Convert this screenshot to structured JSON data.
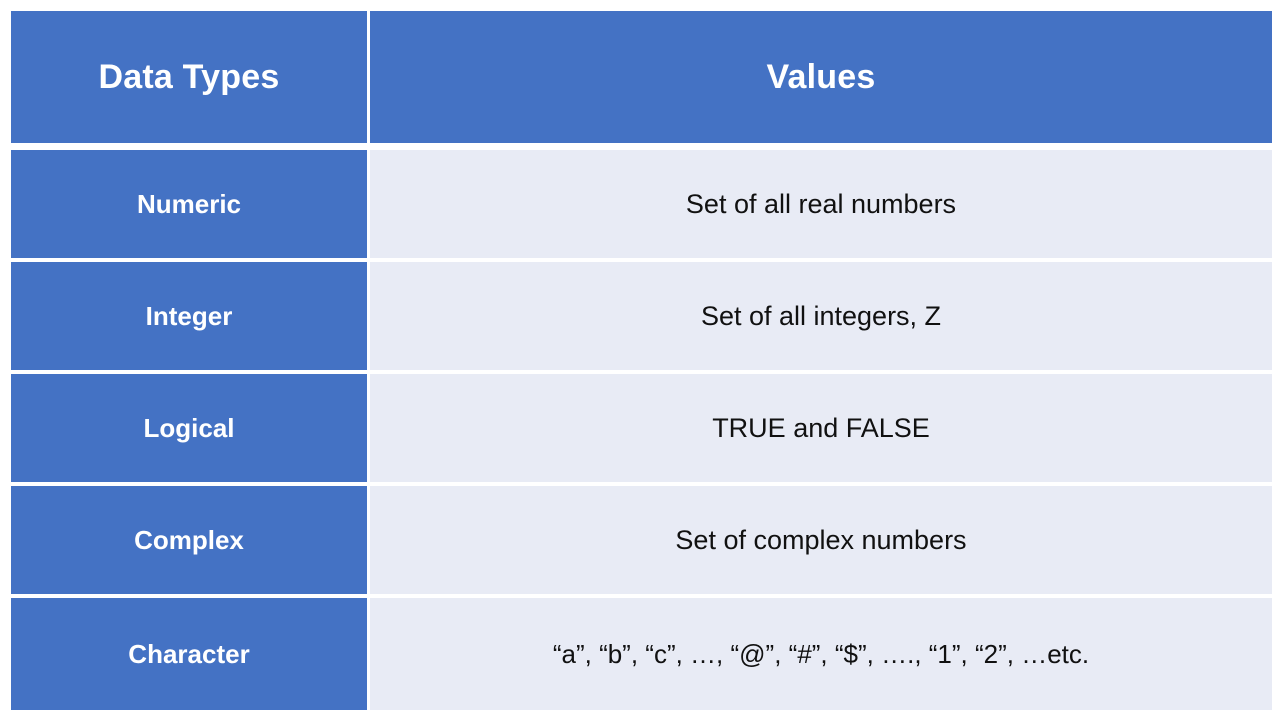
{
  "table": {
    "headers": {
      "type_column": "Data Types",
      "value_column": "Values"
    },
    "rows": [
      {
        "type": "Numeric",
        "value": "Set of all real numbers"
      },
      {
        "type": "Integer",
        "value": "Set of all integers, Z"
      },
      {
        "type": "Logical",
        "value": "TRUE and FALSE"
      },
      {
        "type": "Complex",
        "value": "Set of complex numbers"
      },
      {
        "type": "Character",
        "value": "“a”, “b”, “c”, …, “@”, “#”, “$”, …., “1”, “2”, …etc."
      }
    ]
  },
  "colors": {
    "header_blue": "#4472C4",
    "row_label_blue": "#4472C4",
    "value_background": "#E8EBF5",
    "header_text": "#FFFFFF",
    "value_text": "#111111",
    "grid_line": "#FFFFFF",
    "page_background": "#FFFFFF"
  }
}
